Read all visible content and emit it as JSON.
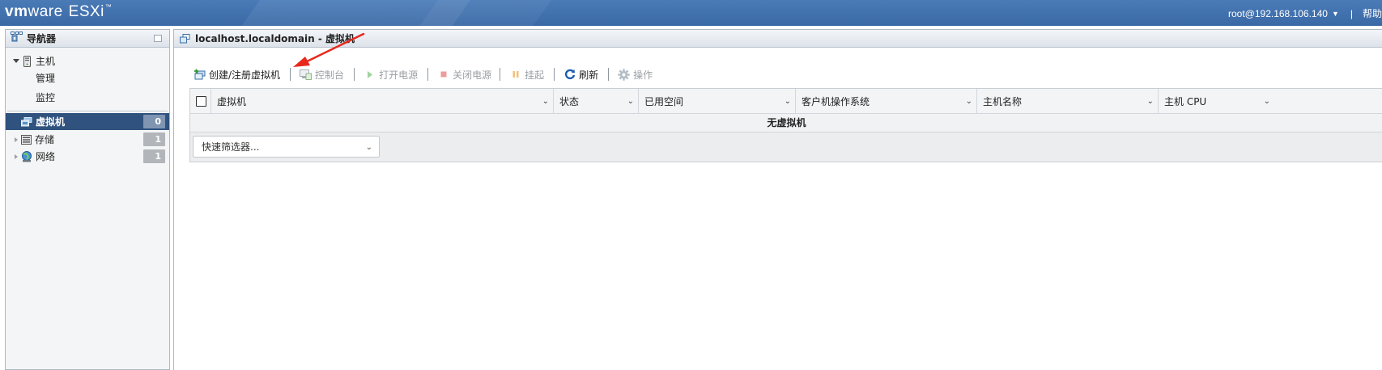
{
  "header": {
    "brand_vm": "vm",
    "brand_ware": "ware",
    "brand_product": "ESXi",
    "brand_tm": "™",
    "user": "root@192.168.106.140",
    "separator": "|",
    "help": "帮助"
  },
  "navigator": {
    "title": "导航器",
    "host": {
      "label": "主机",
      "children": [
        "管理",
        "监控"
      ]
    },
    "items": [
      {
        "label": "虚拟机",
        "count": "0",
        "selected": true,
        "icon": "vm-icon"
      },
      {
        "label": "存储",
        "count": "1",
        "selected": false,
        "icon": "storage-icon"
      },
      {
        "label": "网络",
        "count": "1",
        "selected": false,
        "icon": "network-icon"
      }
    ]
  },
  "main": {
    "title": "localhost.localdomain - 虚拟机",
    "toolbar": {
      "create": "创建/注册虚拟机",
      "console": "控制台",
      "power_on": "打开电源",
      "power_off": "关闭电源",
      "suspend": "挂起",
      "refresh": "刷新",
      "actions": "操作"
    },
    "grid": {
      "columns": [
        "虚拟机",
        "状态",
        "已用空间",
        "客户机操作系统",
        "主机名称",
        "主机 CPU"
      ],
      "empty_text": "无虚拟机",
      "filter_placeholder": "快速筛选器..."
    }
  },
  "colors": {
    "header_bg": "#3f70ad",
    "nav_selected_bg": "#30527e",
    "annotation_arrow": "#e8281e"
  }
}
